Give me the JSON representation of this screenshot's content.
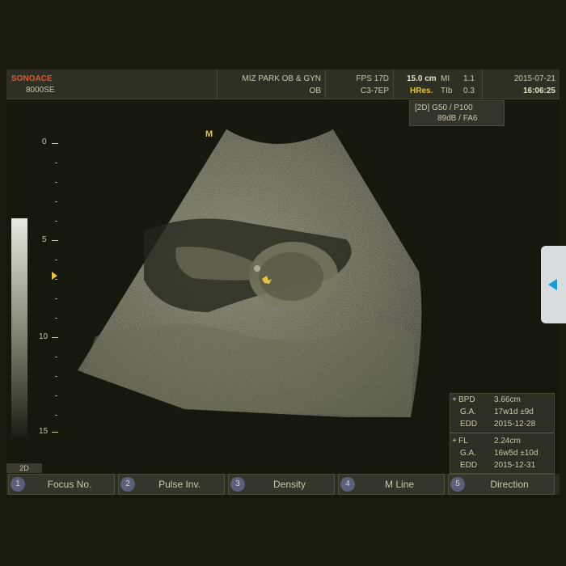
{
  "header": {
    "brand": "SONOACE",
    "model": "8000SE",
    "institution": "MIZ PARK OB & GYN",
    "exam": "OB",
    "fps": "FPS 17D",
    "probe": "C3-7EP",
    "depth": "15.0 cm",
    "hres": "HRes.",
    "mi_label": "MI",
    "mi_value": "1.1",
    "tib_label": "TIb",
    "tib_value": "0.3",
    "date": "2015-07-21",
    "time": "16:06:25"
  },
  "params": {
    "line1": "[2D] G50 / P100",
    "line2": "89dB / FA6"
  },
  "image": {
    "marker": "M",
    "depth_labels": [
      "0",
      "5",
      "10",
      "15"
    ]
  },
  "measurements": {
    "bpd": {
      "label": "BPD",
      "value": "3.66cm",
      "ga_label": "G.A.",
      "ga": "17w1d ±9d",
      "edd_label": "EDD",
      "edd": "2015-12-28"
    },
    "fl": {
      "label": "FL",
      "value": "2.24cm",
      "ga_label": "G.A.",
      "ga": "16w5d ±10d",
      "edd_label": "EDD",
      "edd": "2015-12-31"
    }
  },
  "mode_tab": "2D",
  "softkeys": [
    {
      "num": "1",
      "label": "Focus No."
    },
    {
      "num": "2",
      "label": "Pulse Inv."
    },
    {
      "num": "3",
      "label": "Density"
    },
    {
      "num": "4",
      "label": "M Line"
    },
    {
      "num": "5",
      "label": "Direction"
    }
  ],
  "colors": {
    "accent": "#e7c43d",
    "brand": "#e0562a",
    "fl_cursor": "#6fd36f",
    "side_tab_arrow": "#1a9ad6"
  }
}
